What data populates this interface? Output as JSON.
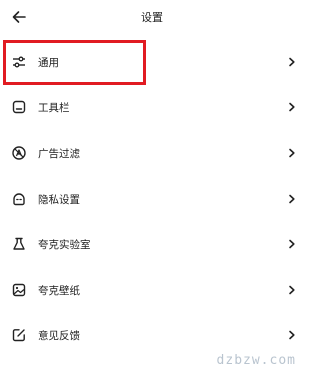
{
  "header": {
    "title": "设置",
    "back_icon": "arrow-left-icon"
  },
  "settings": [
    {
      "label": "通用",
      "icon": "sliders-icon",
      "highlighted": true
    },
    {
      "label": "工具栏",
      "icon": "toolbar-icon"
    },
    {
      "label": "广告过滤",
      "icon": "ad-block-icon"
    },
    {
      "label": "隐私设置",
      "icon": "privacy-face-icon"
    },
    {
      "label": "夸克实验室",
      "icon": "flask-icon"
    },
    {
      "label": "夸克壁纸",
      "icon": "image-icon"
    },
    {
      "label": "意见反馈",
      "icon": "edit-feedback-icon"
    }
  ],
  "chevron_icon": "chevron-right-icon",
  "watermark": "dzbzw.com",
  "colors": {
    "highlight": "#e11b22",
    "text": "#222222",
    "watermark": "#b9c4cf"
  }
}
